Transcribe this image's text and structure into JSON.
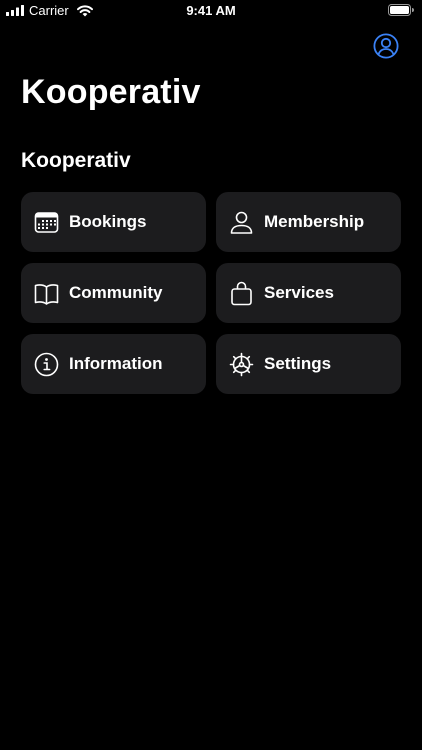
{
  "status_bar": {
    "carrier": "Carrier",
    "time": "9:41 AM"
  },
  "navigation": {
    "large_title": "Kooperativ",
    "profile_icon": "person-circle-icon"
  },
  "section": {
    "title": "Kooperativ"
  },
  "tiles": [
    {
      "label": "Bookings",
      "icon": "calendar-icon"
    },
    {
      "label": "Membership",
      "icon": "person-icon"
    },
    {
      "label": "Community",
      "icon": "book-icon"
    },
    {
      "label": "Services",
      "icon": "bag-icon"
    },
    {
      "label": "Information",
      "icon": "info-circle-icon"
    },
    {
      "label": "Settings",
      "icon": "gear-icon"
    }
  ],
  "colors": {
    "background": "#000000",
    "tile_background": "#1c1c1e",
    "text": "#ffffff",
    "accent": "#3b82f6"
  }
}
